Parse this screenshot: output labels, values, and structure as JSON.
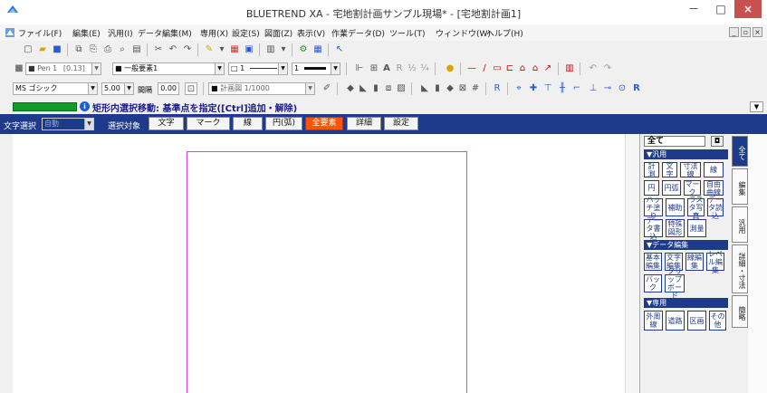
{
  "window": {
    "title": "BLUETREND XA - 宅地割計画サンプル現場* - [宅地割計画1]",
    "minimize": "－",
    "maximize": "□",
    "close": "×"
  },
  "menu": {
    "items": [
      "ファイル(F)",
      "編集(E)",
      "汎用(I)",
      "データ編集(M)",
      "専用(X)",
      "設定(S)",
      "図面(Z)",
      "表示(V)",
      "作業データ(D)",
      "ツール(T)",
      "ウィンドウ(W)",
      "ヘルプ(H)"
    ],
    "mdi_min": "_",
    "mdi_restore": "▫",
    "mdi_close": "×"
  },
  "toolbar2": {
    "pen_label": "Pen 1",
    "pen_width": "[0.13]",
    "layer_label": "一般要素1",
    "line_type": "1",
    "line_width": "1"
  },
  "toolbar3": {
    "font_name": "MS ゴシック",
    "font_size": "5.00",
    "spacing_label": "間隔",
    "spacing_value": "0.00",
    "plan_label": "計画図 1/1000"
  },
  "command": {
    "prompt": "矩形内選択移動: 基準点を指定([Ctrl]追加・解除)",
    "info_icon": "i"
  },
  "selection_bar": {
    "text_select_label": "文字選択",
    "auto_value": "自動",
    "target_label": "選択対象",
    "buttons": [
      "文字",
      "マーク",
      "線",
      "円(弧)",
      "全要素",
      "詳細",
      "設定"
    ],
    "active_button": "全要素"
  },
  "palette": {
    "all_label": "全て",
    "pin": "◘",
    "sections": [
      {
        "title": "▼汎用",
        "buttons": [
          "計測",
          "文字",
          "寸法線",
          "線",
          "円",
          "円弧",
          "マーク",
          "自由曲線",
          "ハッチ塗り",
          "補助",
          "ラスタ写真",
          "データ読込",
          "データ書込",
          "特殊図形",
          "測量"
        ]
      },
      {
        "title": "▼データ編集",
        "buttons": [
          "基本編集",
          "文字編集",
          "線編集",
          "レベル編集",
          "バック",
          "クリップボード"
        ]
      },
      {
        "title": "▼専用",
        "buttons": [
          "外周線",
          "道路",
          "区画",
          "その他"
        ]
      }
    ]
  },
  "vertical_tabs": [
    "全て",
    "編集",
    "汎用",
    "詳細・寸法",
    "簡略"
  ]
}
